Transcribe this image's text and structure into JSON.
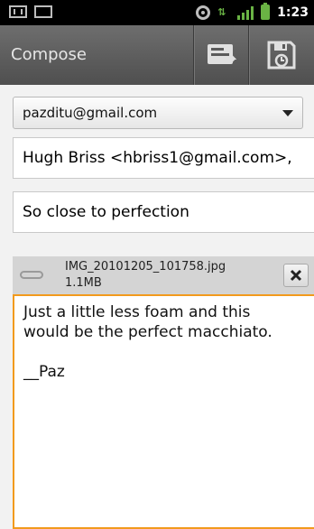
{
  "status_bar": {
    "time": "1:23",
    "icons": [
      "gmail-notification-icon",
      "calendar-notification-icon",
      "gps-icon",
      "data-icon",
      "signal-icon",
      "battery-icon"
    ]
  },
  "header": {
    "title": "Compose",
    "actions": [
      "send-icon",
      "save-draft-icon"
    ]
  },
  "compose": {
    "from": "pazditu@gmail.com",
    "to": "Hugh Briss <hbriss1@gmail.com>,",
    "subject": "So close to perfection",
    "attachment": {
      "filename": "IMG_20101205_101758.jpg",
      "size": "1.1MB"
    },
    "body_lines": [
      "Just a little less foam and this",
      "would be the perfect macchiato.",
      "",
      "__Paz"
    ]
  },
  "colors": {
    "accent_focus": "#f29a1d",
    "status_green": "#6ab344",
    "titlebar": "#5a5a5a"
  }
}
